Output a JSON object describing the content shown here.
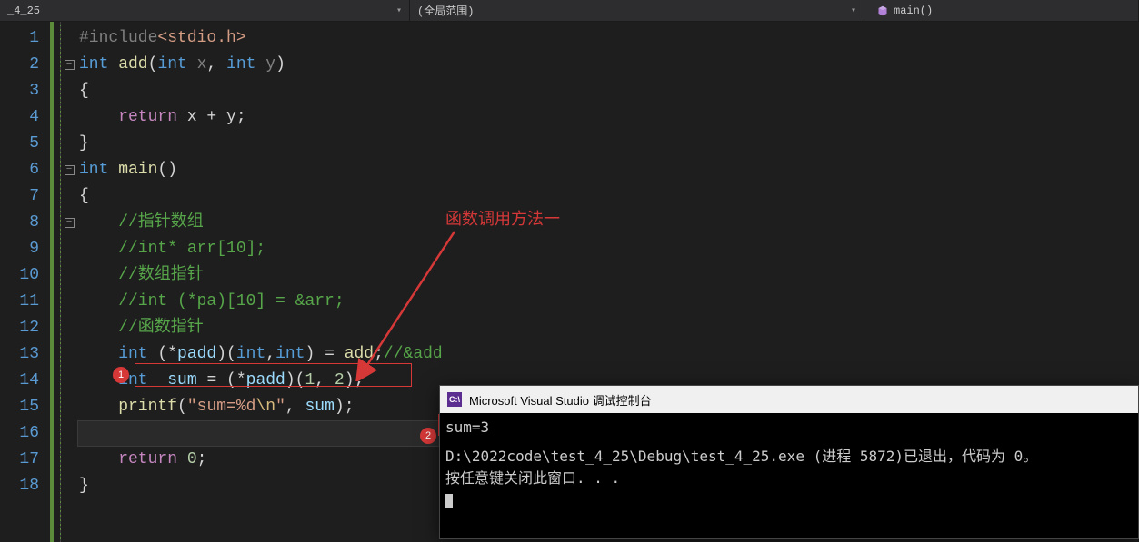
{
  "topbar": {
    "file_tab": "_4_25",
    "scope": "(全局范围)",
    "member": "main()"
  },
  "gutter": {
    "lines": [
      "1",
      "2",
      "3",
      "4",
      "5",
      "6",
      "7",
      "8",
      "9",
      "10",
      "11",
      "12",
      "13",
      "14",
      "15",
      "16",
      "17",
      "18"
    ]
  },
  "code": {
    "l1_include": "#include",
    "l1_header": "<stdio.h>",
    "l2_int": "int",
    "l2_add": " add",
    "l2_parenopen": "(",
    "l2_int2": "int",
    "l2_x": " x",
    "l2_comma": ", ",
    "l2_int3": "int",
    "l2_y": " y",
    "l2_parenclose": ")",
    "l3_brace": "{",
    "l4_return": "    return",
    "l4_expr": " x + y;",
    "l5_brace": "}",
    "l6_int": "int",
    "l6_main": " main",
    "l6_paren": "()",
    "l7_brace": "{",
    "l8_comment": "    //指针数组",
    "l9_comment": "    //int* arr[10];",
    "l10_comment": "    //数组指针",
    "l11_comment": "    //int (*pa)[10] = &arr;",
    "l12_comment": "    //函数指针",
    "l13_int": "    int",
    "l13_rest1": " (*",
    "l13_padd": "padd",
    "l13_rest2": ")(",
    "l13_intp1": "int",
    "l13_comma": ",",
    "l13_intp2": "int",
    "l13_rest3": ") = ",
    "l13_addref": "add",
    "l13_semi": ";",
    "l13_comment": "//&add",
    "l14_int": "    int",
    "l14_sum": "  sum",
    "l14_eq": " = (*",
    "l14_padd": "padd",
    "l14_close": ")(",
    "l14_n1": "1",
    "l14_c": ", ",
    "l14_n2": "2",
    "l14_end": ");",
    "l15_printf": "    printf",
    "l15_open": "(",
    "l15_q1": "\"",
    "l15_str": "sum=%d",
    "l15_esc": "\\n",
    "l15_q2": "\"",
    "l15_c": ", ",
    "l15_sum": "sum",
    "l15_end": ");",
    "l17_return": "    return",
    "l17_zero": " 0",
    "l17_semi": ";",
    "l18_brace": "}"
  },
  "annotation": {
    "label": "函数调用方法一",
    "badge1": "1",
    "badge2": "2"
  },
  "console": {
    "title": "Microsoft Visual Studio 调试控制台",
    "line1": "sum=3",
    "line2": "D:\\2022code\\test_4_25\\Debug\\test_4_25.exe (进程 5872)已退出，代码为 0。",
    "line3": "按任意键关闭此窗口. . ."
  }
}
